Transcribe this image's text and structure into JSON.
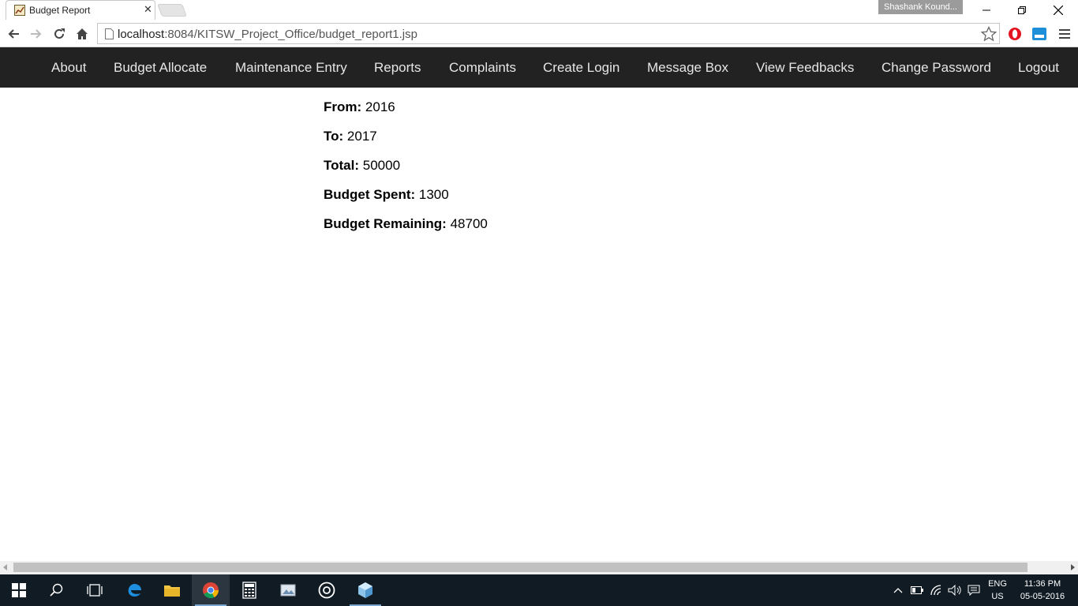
{
  "browser": {
    "tab_title": "Budget Report",
    "tab_close": "✕",
    "profile_name": "Shashank Kound...",
    "url_host": "localhost",
    "url_rest": ":8084/KITSW_Project_Office/budget_report1.jsp"
  },
  "nav": {
    "items": [
      "About",
      "Budget Allocate",
      "Maintenance Entry",
      "Reports",
      "Complaints",
      "Create Login",
      "Message Box",
      "View Feedbacks",
      "Change Password",
      "Logout"
    ]
  },
  "report": {
    "rows": [
      {
        "label": "From:",
        "value": "2016"
      },
      {
        "label": "To:",
        "value": "2017"
      },
      {
        "label": "Total:",
        "value": "50000"
      },
      {
        "label": "Budget Spent:",
        "value": "1300"
      },
      {
        "label": "Budget Remaining:",
        "value": "48700"
      }
    ]
  },
  "taskbar": {
    "lang_line1": "ENG",
    "lang_line2": "US",
    "time": "11:36 PM",
    "date": "05-05-2016"
  },
  "colors": {
    "navbar_bg": "#222222",
    "nav_text": "#e6e6e6",
    "taskbar_bg": "#101b24"
  }
}
